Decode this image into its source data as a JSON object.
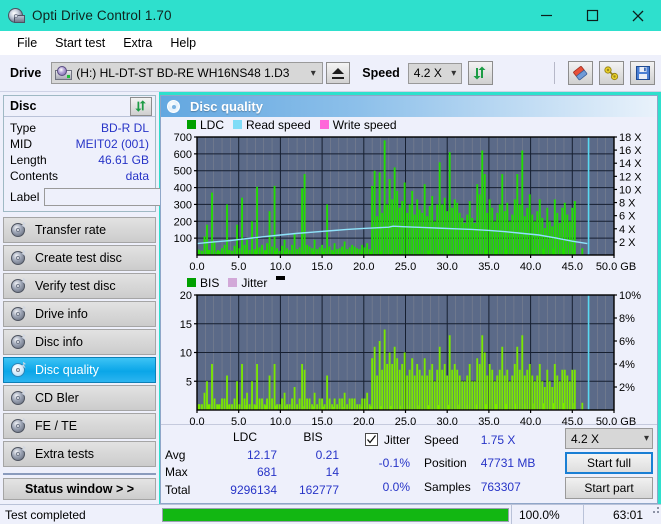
{
  "window": {
    "title": "Opti Drive Control 1.70",
    "app_icon": "disc-drive-icon",
    "minimize": "—",
    "maximize": "□",
    "close": "×",
    "titlebar_color": "#2ee0cd"
  },
  "menu": {
    "items": [
      {
        "label": "File"
      },
      {
        "label": "Start test"
      },
      {
        "label": "Extra"
      },
      {
        "label": "Help"
      }
    ]
  },
  "toolbar": {
    "drive_label": "Drive",
    "drive_value": "(H:)  HL-DT-ST BD-RE  WH16NS48 1.D3",
    "eject_label": "Eject",
    "speed_label": "Speed",
    "speed_value": "4.2 X",
    "refresh_icon": "refresh-arrows-icon",
    "erase_icon": "eraser-icon",
    "tools_icon": "wrench-icon",
    "save_icon": "floppy-save-icon"
  },
  "disc_panel": {
    "title": "Disc",
    "refresh_icon": "refresh-arrows-icon",
    "rows": [
      {
        "label": "Type",
        "value": "BD-R DL"
      },
      {
        "label": "MID",
        "value": "MEIT02 (001)"
      },
      {
        "label": "Length",
        "value": "46.61 GB"
      },
      {
        "label": "Contents",
        "value": "data"
      }
    ],
    "label_field_label": "Label",
    "label_field_value": "",
    "label_field_placeholder": "",
    "disc_button_icon": "cd-disc-icon"
  },
  "sidebar": {
    "items": [
      {
        "label": "Transfer rate",
        "selected": false
      },
      {
        "label": "Create test disc",
        "selected": false
      },
      {
        "label": "Verify test disc",
        "selected": false
      },
      {
        "label": "Drive info",
        "selected": false
      },
      {
        "label": "Disc info",
        "selected": false
      },
      {
        "label": "Disc quality",
        "selected": true
      },
      {
        "label": "CD Bler",
        "selected": false
      },
      {
        "label": "FE / TE",
        "selected": false
      },
      {
        "label": "Extra tests",
        "selected": false
      }
    ],
    "status_window_button": "Status window > >"
  },
  "panel": {
    "title": "Disc quality",
    "icon": "disc-quality-icon"
  },
  "stats": {
    "columns": [
      "LDC",
      "BIS"
    ],
    "rows": [
      {
        "label": "Avg",
        "ldc": "12.17",
        "bis": "0.21"
      },
      {
        "label": "Max",
        "ldc": "681",
        "bis": "14"
      },
      {
        "label": "Total",
        "ldc": "9296134",
        "bis": "162777"
      }
    ],
    "jitter": {
      "label": "Jitter",
      "checked": true,
      "avg": "-0.1%",
      "max": "0.0%"
    },
    "speed": {
      "label": "Speed",
      "value": "1.75 X"
    },
    "position": {
      "label": "Position",
      "value": "47731 MB"
    },
    "samples": {
      "label": "Samples",
      "value": "763307"
    },
    "speed_select": "4.2 X",
    "start_full_button": "Start full",
    "start_part_button": "Start part"
  },
  "statusbar": {
    "message": "Test completed",
    "progress_percent_label": "100.0%",
    "progress_value": 100,
    "elapsed": "63:01",
    "bar_color": "#12b712"
  },
  "chart_data": [
    {
      "type": "area",
      "title": "Disc quality - LDC",
      "xlabel": "GB",
      "ylabel": "LDC",
      "xlim": [
        0,
        50
      ],
      "ylim": [
        0,
        700
      ],
      "y2lim": [
        0,
        18
      ],
      "y2label": "X",
      "xticks": [
        "0.0",
        "5.0",
        "10.0",
        "15.0",
        "20.0",
        "25.0",
        "30.0",
        "35.0",
        "40.0",
        "45.0",
        "50.0 GB"
      ],
      "yticks": [
        100,
        200,
        300,
        400,
        500,
        600,
        700
      ],
      "y2ticks": [
        "2 X",
        "4 X",
        "6 X",
        "8 X",
        "10 X",
        "12 X",
        "14 X",
        "16 X",
        "18 X"
      ],
      "grid": true,
      "legend_position": "top-left",
      "plot_bg": "#5b6a88",
      "legend": [
        {
          "name": "LDC",
          "color": "#00a000"
        },
        {
          "name": "Read speed",
          "color": "#7fdcf7"
        },
        {
          "name": "Write speed",
          "color": "#ff66d9"
        }
      ],
      "series": [
        {
          "name": "LDC",
          "color": "#22dd00",
          "kind": "impulse",
          "x": [
            0.3,
            0.6,
            0.9,
            1.2,
            1.5,
            1.8,
            2.1,
            2.4,
            2.7,
            3.0,
            3.3,
            3.6,
            3.9,
            4.2,
            4.5,
            4.8,
            5.1,
            5.4,
            5.7,
            6.0,
            6.3,
            6.6,
            6.9,
            7.2,
            7.5,
            7.8,
            8.1,
            8.4,
            8.7,
            9.0,
            9.3,
            9.6,
            9.9,
            10.2,
            10.5,
            10.8,
            11.1,
            11.4,
            11.7,
            12.0,
            12.3,
            12.6,
            12.9,
            13.2,
            13.5,
            13.8,
            14.1,
            14.4,
            14.7,
            15.0,
            15.3,
            15.6,
            15.9,
            16.2,
            16.5,
            16.8,
            17.1,
            17.4,
            17.7,
            18.0,
            18.3,
            18.6,
            18.9,
            19.2,
            19.5,
            19.8,
            20.1,
            20.4,
            20.7,
            21.0,
            21.3,
            21.6,
            21.9,
            22.2,
            22.5,
            22.8,
            23.1,
            23.4,
            23.7,
            24.0,
            24.3,
            24.6,
            24.9,
            25.2,
            25.5,
            25.8,
            26.1,
            26.4,
            26.7,
            27.0,
            27.3,
            27.6,
            27.9,
            28.2,
            28.5,
            28.8,
            29.1,
            29.4,
            29.7,
            30.0,
            30.3,
            30.6,
            30.9,
            31.2,
            31.5,
            31.8,
            32.1,
            32.4,
            32.7,
            33.0,
            33.3,
            33.6,
            33.9,
            34.2,
            34.5,
            34.8,
            35.1,
            35.4,
            35.7,
            36.0,
            36.3,
            36.6,
            36.9,
            37.2,
            37.5,
            37.8,
            38.1,
            38.4,
            38.7,
            39.0,
            39.3,
            39.6,
            39.9,
            40.2,
            40.5,
            40.8,
            41.1,
            41.4,
            41.7,
            42.0,
            42.3,
            42.6,
            42.9,
            43.2,
            43.5,
            43.8,
            44.1,
            44.4,
            44.7,
            45.0,
            45.3,
            45.6,
            45.9,
            46.2,
            46.5,
            46.8
          ],
          "values": [
            30,
            25,
            110,
            180,
            30,
            370,
            80,
            20,
            25,
            40,
            60,
            300,
            30,
            25,
            55,
            180,
            40,
            340,
            60,
            90,
            30,
            200,
            35,
            405,
            45,
            60,
            30,
            70,
            260,
            50,
            410,
            40,
            25,
            55,
            90,
            40,
            30,
            60,
            130,
            35,
            45,
            395,
            480,
            60,
            50,
            40,
            90,
            35,
            45,
            60,
            40,
            300,
            50,
            30,
            70,
            35,
            40,
            50,
            80,
            35,
            45,
            60,
            50,
            40,
            35,
            60,
            45,
            70,
            35,
            410,
            500,
            230,
            490,
            250,
            680,
            300,
            450,
            330,
            520,
            380,
            280,
            320,
            430,
            250,
            300,
            380,
            240,
            330,
            270,
            250,
            420,
            230,
            290,
            350,
            200,
            300,
            550,
            300,
            340,
            260,
            610,
            280,
            330,
            310,
            250,
            220,
            190,
            240,
            320,
            220,
            190,
            420,
            360,
            620,
            480,
            250,
            330,
            280,
            200,
            250,
            300,
            480,
            260,
            310,
            200,
            240,
            330,
            480,
            300,
            620,
            230,
            280,
            360,
            240,
            200,
            260,
            330,
            220,
            160,
            280,
            200,
            170,
            330,
            250,
            190,
            280,
            310,
            240,
            200,
            280,
            320
          ]
        },
        {
          "name": "Read speed",
          "color": "#8fe3fa",
          "kind": "line",
          "x": [
            0.0,
            2.0,
            4.0,
            6.0,
            8.0,
            10.0,
            12.0,
            14.0,
            16.0,
            18.0,
            20.0,
            21.5,
            23.0,
            23.5,
            25.0,
            27.0,
            29.0,
            31.0,
            33.0,
            35.0,
            37.0,
            39.0,
            41.0,
            43.0,
            45.0,
            46.8
          ],
          "values_x_speed": [
            1.75,
            2.0,
            2.2,
            2.5,
            2.8,
            3.05,
            3.3,
            3.5,
            3.7,
            3.9,
            4.05,
            4.15,
            4.25,
            4.4,
            4.3,
            4.2,
            4.1,
            4.0,
            3.9,
            3.75,
            3.55,
            3.3,
            3.05,
            2.6,
            2.1,
            1.75
          ]
        },
        {
          "name": "end-marker",
          "color": "#59d8f2",
          "kind": "vline",
          "x": 46.95
        }
      ]
    },
    {
      "type": "area",
      "title": "Disc quality - BIS",
      "xlabel": "GB",
      "ylabel": "BIS",
      "xlim": [
        0,
        50
      ],
      "ylim": [
        0,
        20
      ],
      "y2lim": [
        0,
        10
      ],
      "y2label": "%",
      "xticks": [
        "0.0",
        "5.0",
        "10.0",
        "15.0",
        "20.0",
        "25.0",
        "30.0",
        "35.0",
        "40.0",
        "45.0",
        "50.0 GB"
      ],
      "yticks": [
        5,
        10,
        15,
        20
      ],
      "y2ticks": [
        "2%",
        "4%",
        "6%",
        "8%",
        "10%"
      ],
      "grid": true,
      "legend_position": "top-left",
      "plot_bg": "#5b6a88",
      "legend": [
        {
          "name": "BIS",
          "color": "#00a000"
        },
        {
          "name": "Jitter",
          "color": "#d2a8d8"
        }
      ],
      "series": [
        {
          "name": "BIS",
          "color": "#7ae800",
          "kind": "impulse",
          "x": [
            0.3,
            0.6,
            0.9,
            1.2,
            1.5,
            1.8,
            2.1,
            2.4,
            2.7,
            3.0,
            3.3,
            3.6,
            3.9,
            4.2,
            4.5,
            4.8,
            5.1,
            5.4,
            5.7,
            6.0,
            6.3,
            6.6,
            6.9,
            7.2,
            7.5,
            7.8,
            8.1,
            8.4,
            8.7,
            9.0,
            9.3,
            9.6,
            9.9,
            10.2,
            10.5,
            10.8,
            11.1,
            11.4,
            11.7,
            12.0,
            12.3,
            12.6,
            12.9,
            13.2,
            13.5,
            13.8,
            14.1,
            14.4,
            14.7,
            15.0,
            15.3,
            15.6,
            15.9,
            16.2,
            16.5,
            16.8,
            17.1,
            17.4,
            17.7,
            18.0,
            18.3,
            18.6,
            18.9,
            19.2,
            19.5,
            19.8,
            20.1,
            20.4,
            20.7,
            21.0,
            21.3,
            21.6,
            21.9,
            22.2,
            22.5,
            22.8,
            23.1,
            23.4,
            23.7,
            24.0,
            24.3,
            24.6,
            24.9,
            25.2,
            25.5,
            25.8,
            26.1,
            26.4,
            26.7,
            27.0,
            27.3,
            27.6,
            27.9,
            28.2,
            28.5,
            28.8,
            29.1,
            29.4,
            29.7,
            30.0,
            30.3,
            30.6,
            30.9,
            31.2,
            31.5,
            31.8,
            32.1,
            32.4,
            32.7,
            33.0,
            33.3,
            33.6,
            33.9,
            34.2,
            34.5,
            34.8,
            35.1,
            35.4,
            35.7,
            36.0,
            36.3,
            36.6,
            36.9,
            37.2,
            37.5,
            37.8,
            38.1,
            38.4,
            38.7,
            39.0,
            39.3,
            39.6,
            39.9,
            40.2,
            40.5,
            40.8,
            41.1,
            41.4,
            41.7,
            42.0,
            42.3,
            42.6,
            42.9,
            43.2,
            43.5,
            43.8,
            44.1,
            44.4,
            44.7,
            45.0,
            45.3,
            45.6,
            45.9,
            46.2,
            46.5,
            46.8
          ],
          "values": [
            1,
            1,
            3,
            5,
            1,
            8,
            2,
            1,
            1,
            2,
            2,
            6,
            1,
            1,
            2,
            5,
            1,
            8,
            2,
            3,
            1,
            5,
            1,
            8,
            2,
            2,
            1,
            2,
            6,
            2,
            8,
            1,
            1,
            2,
            3,
            1,
            1,
            2,
            4,
            1,
            2,
            8,
            7,
            2,
            2,
            1,
            3,
            1,
            2,
            2,
            1,
            6,
            2,
            1,
            2,
            1,
            2,
            2,
            3,
            1,
            2,
            2,
            2,
            1,
            1,
            2,
            2,
            3,
            1,
            9,
            11,
            6,
            12,
            7,
            14,
            8,
            10,
            8,
            11,
            9,
            7,
            8,
            10,
            6,
            7,
            9,
            6,
            8,
            7,
            6,
            9,
            6,
            7,
            8,
            5,
            7,
            11,
            7,
            8,
            6,
            13,
            7,
            8,
            7,
            6,
            5,
            5,
            6,
            8,
            5,
            5,
            9,
            8,
            13,
            10,
            6,
            8,
            7,
            5,
            6,
            7,
            11,
            6,
            7,
            5,
            6,
            8,
            11,
            7,
            13,
            6,
            7,
            8,
            6,
            5,
            6,
            8,
            5,
            4,
            7,
            5,
            4,
            8,
            6,
            5,
            7,
            7,
            6,
            5,
            7,
            7
          ]
        },
        {
          "name": "end-marker",
          "color": "#59d8f2",
          "kind": "vline",
          "x": 46.95
        }
      ]
    }
  ]
}
